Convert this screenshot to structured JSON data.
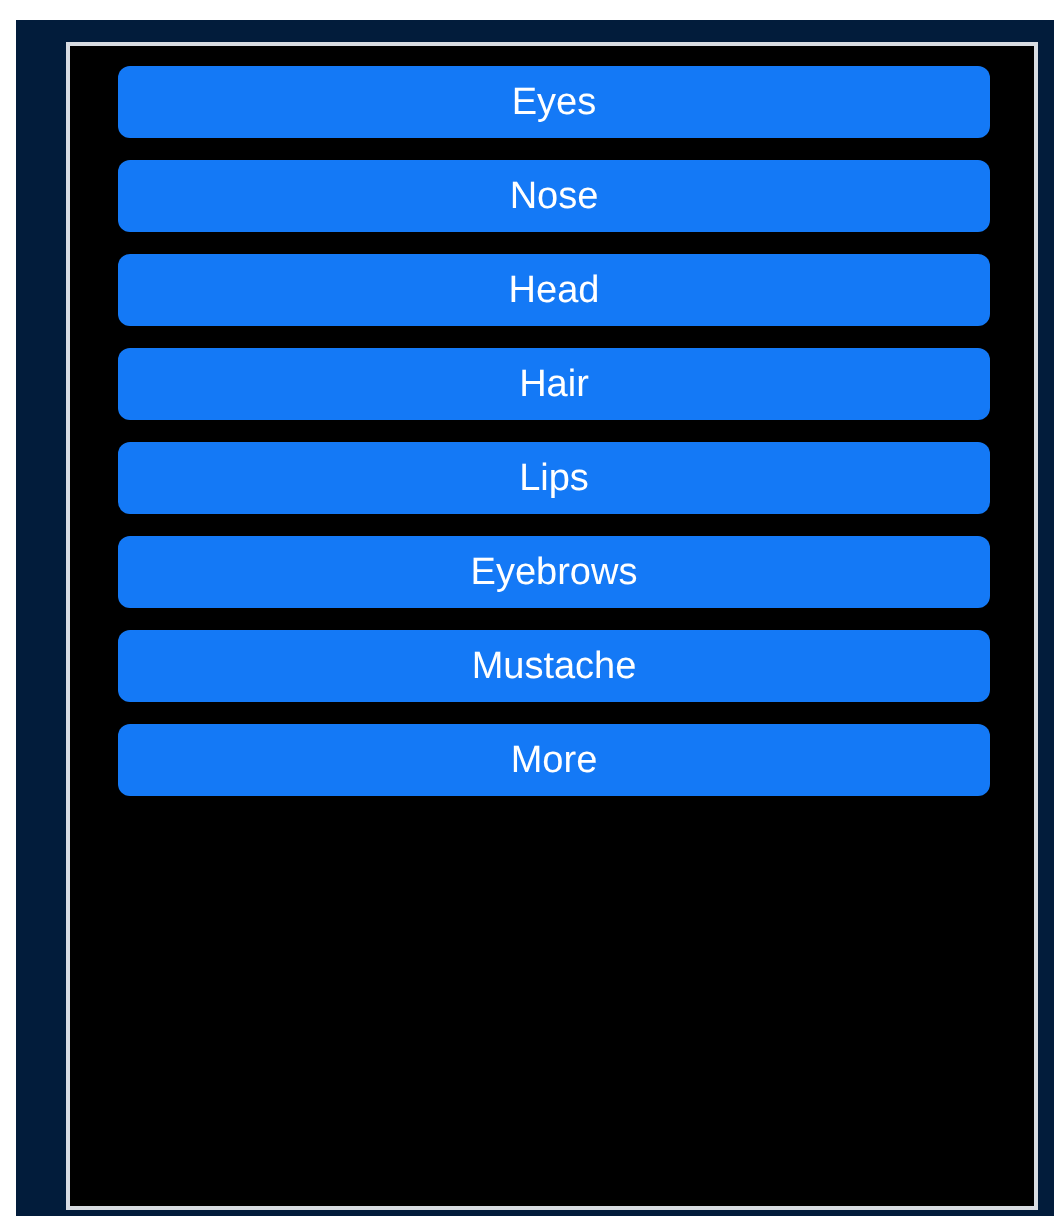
{
  "menu": {
    "buttons": [
      {
        "label": "Eyes"
      },
      {
        "label": "Nose"
      },
      {
        "label": "Head"
      },
      {
        "label": "Hair"
      },
      {
        "label": "Lips"
      },
      {
        "label": "Eyebrows"
      },
      {
        "label": "Mustache"
      },
      {
        "label": "More"
      }
    ]
  }
}
